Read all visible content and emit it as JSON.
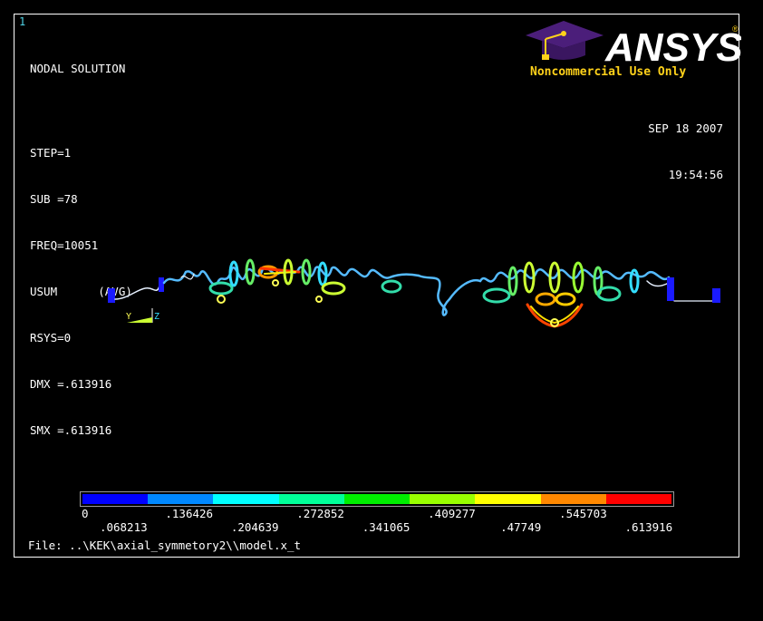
{
  "window": {
    "number": "1"
  },
  "info": {
    "title": "NODAL SOLUTION",
    "lines": [
      "STEP=1",
      "SUB =78",
      "FREQ=10051",
      "USUM      (AVG)",
      "RSYS=0",
      "DMX =.613916",
      "SMX =.613916"
    ]
  },
  "brand": {
    "name": "ANSYS",
    "license": "Noncommercial Use Only"
  },
  "timestamp": {
    "date": "SEP 18 2007",
    "time": "19:54:56"
  },
  "triad": {
    "y": "Y",
    "z": "Z"
  },
  "legend": {
    "colors": [
      "#0000ff",
      "#0088ff",
      "#00ffff",
      "#00ff99",
      "#00ee00",
      "#99ff00",
      "#ffff00",
      "#ff8800",
      "#ff0000"
    ],
    "upper_labels": [
      "0",
      ".136426",
      ".272852",
      ".409277",
      ".545703"
    ],
    "lower_labels": [
      ".068213",
      ".204639",
      ".341065",
      ".47749",
      ".613916"
    ]
  },
  "file": {
    "label": "File:",
    "path": "..\\KEK\\axial_symmetory2\\\\model.x_t"
  }
}
